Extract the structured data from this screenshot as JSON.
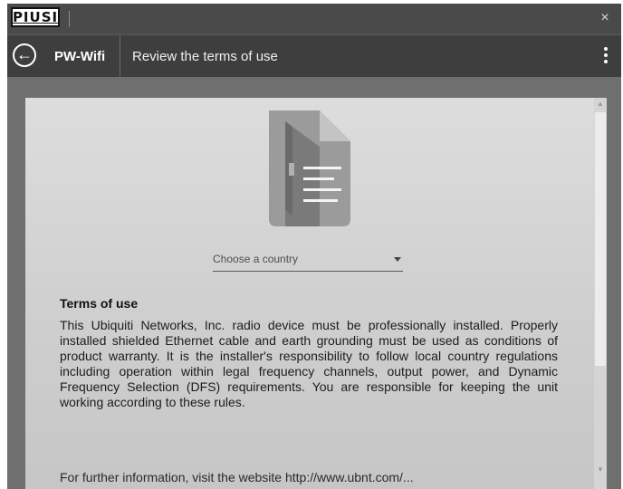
{
  "titlebar": {
    "logo_text": "PIUSI",
    "close_glyph": "×"
  },
  "appbar": {
    "app_name": "PW-Wifi",
    "page_title": "Review the terms of use"
  },
  "country_select": {
    "placeholder": "Choose a country"
  },
  "terms": {
    "title": "Terms of use",
    "body": "This Ubiquiti Networks, Inc. radio device must be professionally installed. Properly installed shielded Ethernet cable and earth grounding must be used as conditions of product warranty. It is the installer's responsibility to follow local country regulations including operation within legal frequency channels, output power, and Dynamic Frequency Selection (DFS) requirements. You are responsible for keeping the unit working according to these rules.",
    "more": "For further information, visit the website http://www.ubnt.com/..."
  },
  "icons": {
    "back": "arrow-left-circle-icon",
    "menu": "kebab-menu-icon",
    "document": "document-icon",
    "dropdown": "caret-down-icon"
  },
  "colors": {
    "appbar_bg": "#3e3e3e",
    "titlebar_bg": "#4a4a4a",
    "overlay_bg": "#6f6f6f",
    "panel_bg": "#d6d6d6"
  }
}
